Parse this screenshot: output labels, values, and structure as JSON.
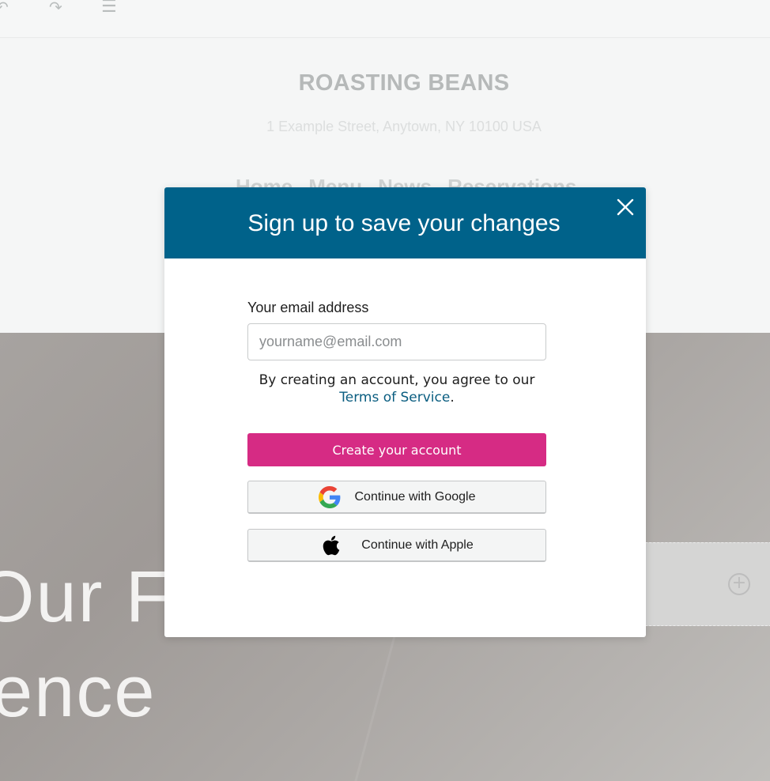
{
  "toolbar": {
    "undo_icon": "undo-icon",
    "redo_icon": "redo-icon",
    "list_icon": "list-icon"
  },
  "site": {
    "title": "ROASTING BEANS",
    "address": "1 Example Street, Anytown, NY 10100 USA",
    "nav": [
      "Home",
      "Menu",
      "News",
      "Reservations"
    ],
    "hero_line_1": "Our Fo",
    "hero_line_2": "ence"
  },
  "modal": {
    "title": "Sign up to save your changes",
    "email_label": "Your email address",
    "email_placeholder": "yourname@email.com",
    "email_value": "",
    "terms_text": "By creating an account, you agree to our",
    "terms_link": "Terms of Service",
    "terms_period": ".",
    "create_label": "Create your account",
    "google_label": "Continue with Google",
    "apple_label": "Continue with Apple"
  },
  "colors": {
    "header_bg": "#00628a",
    "primary_button": "#d62b84",
    "link": "#0a5d80"
  }
}
